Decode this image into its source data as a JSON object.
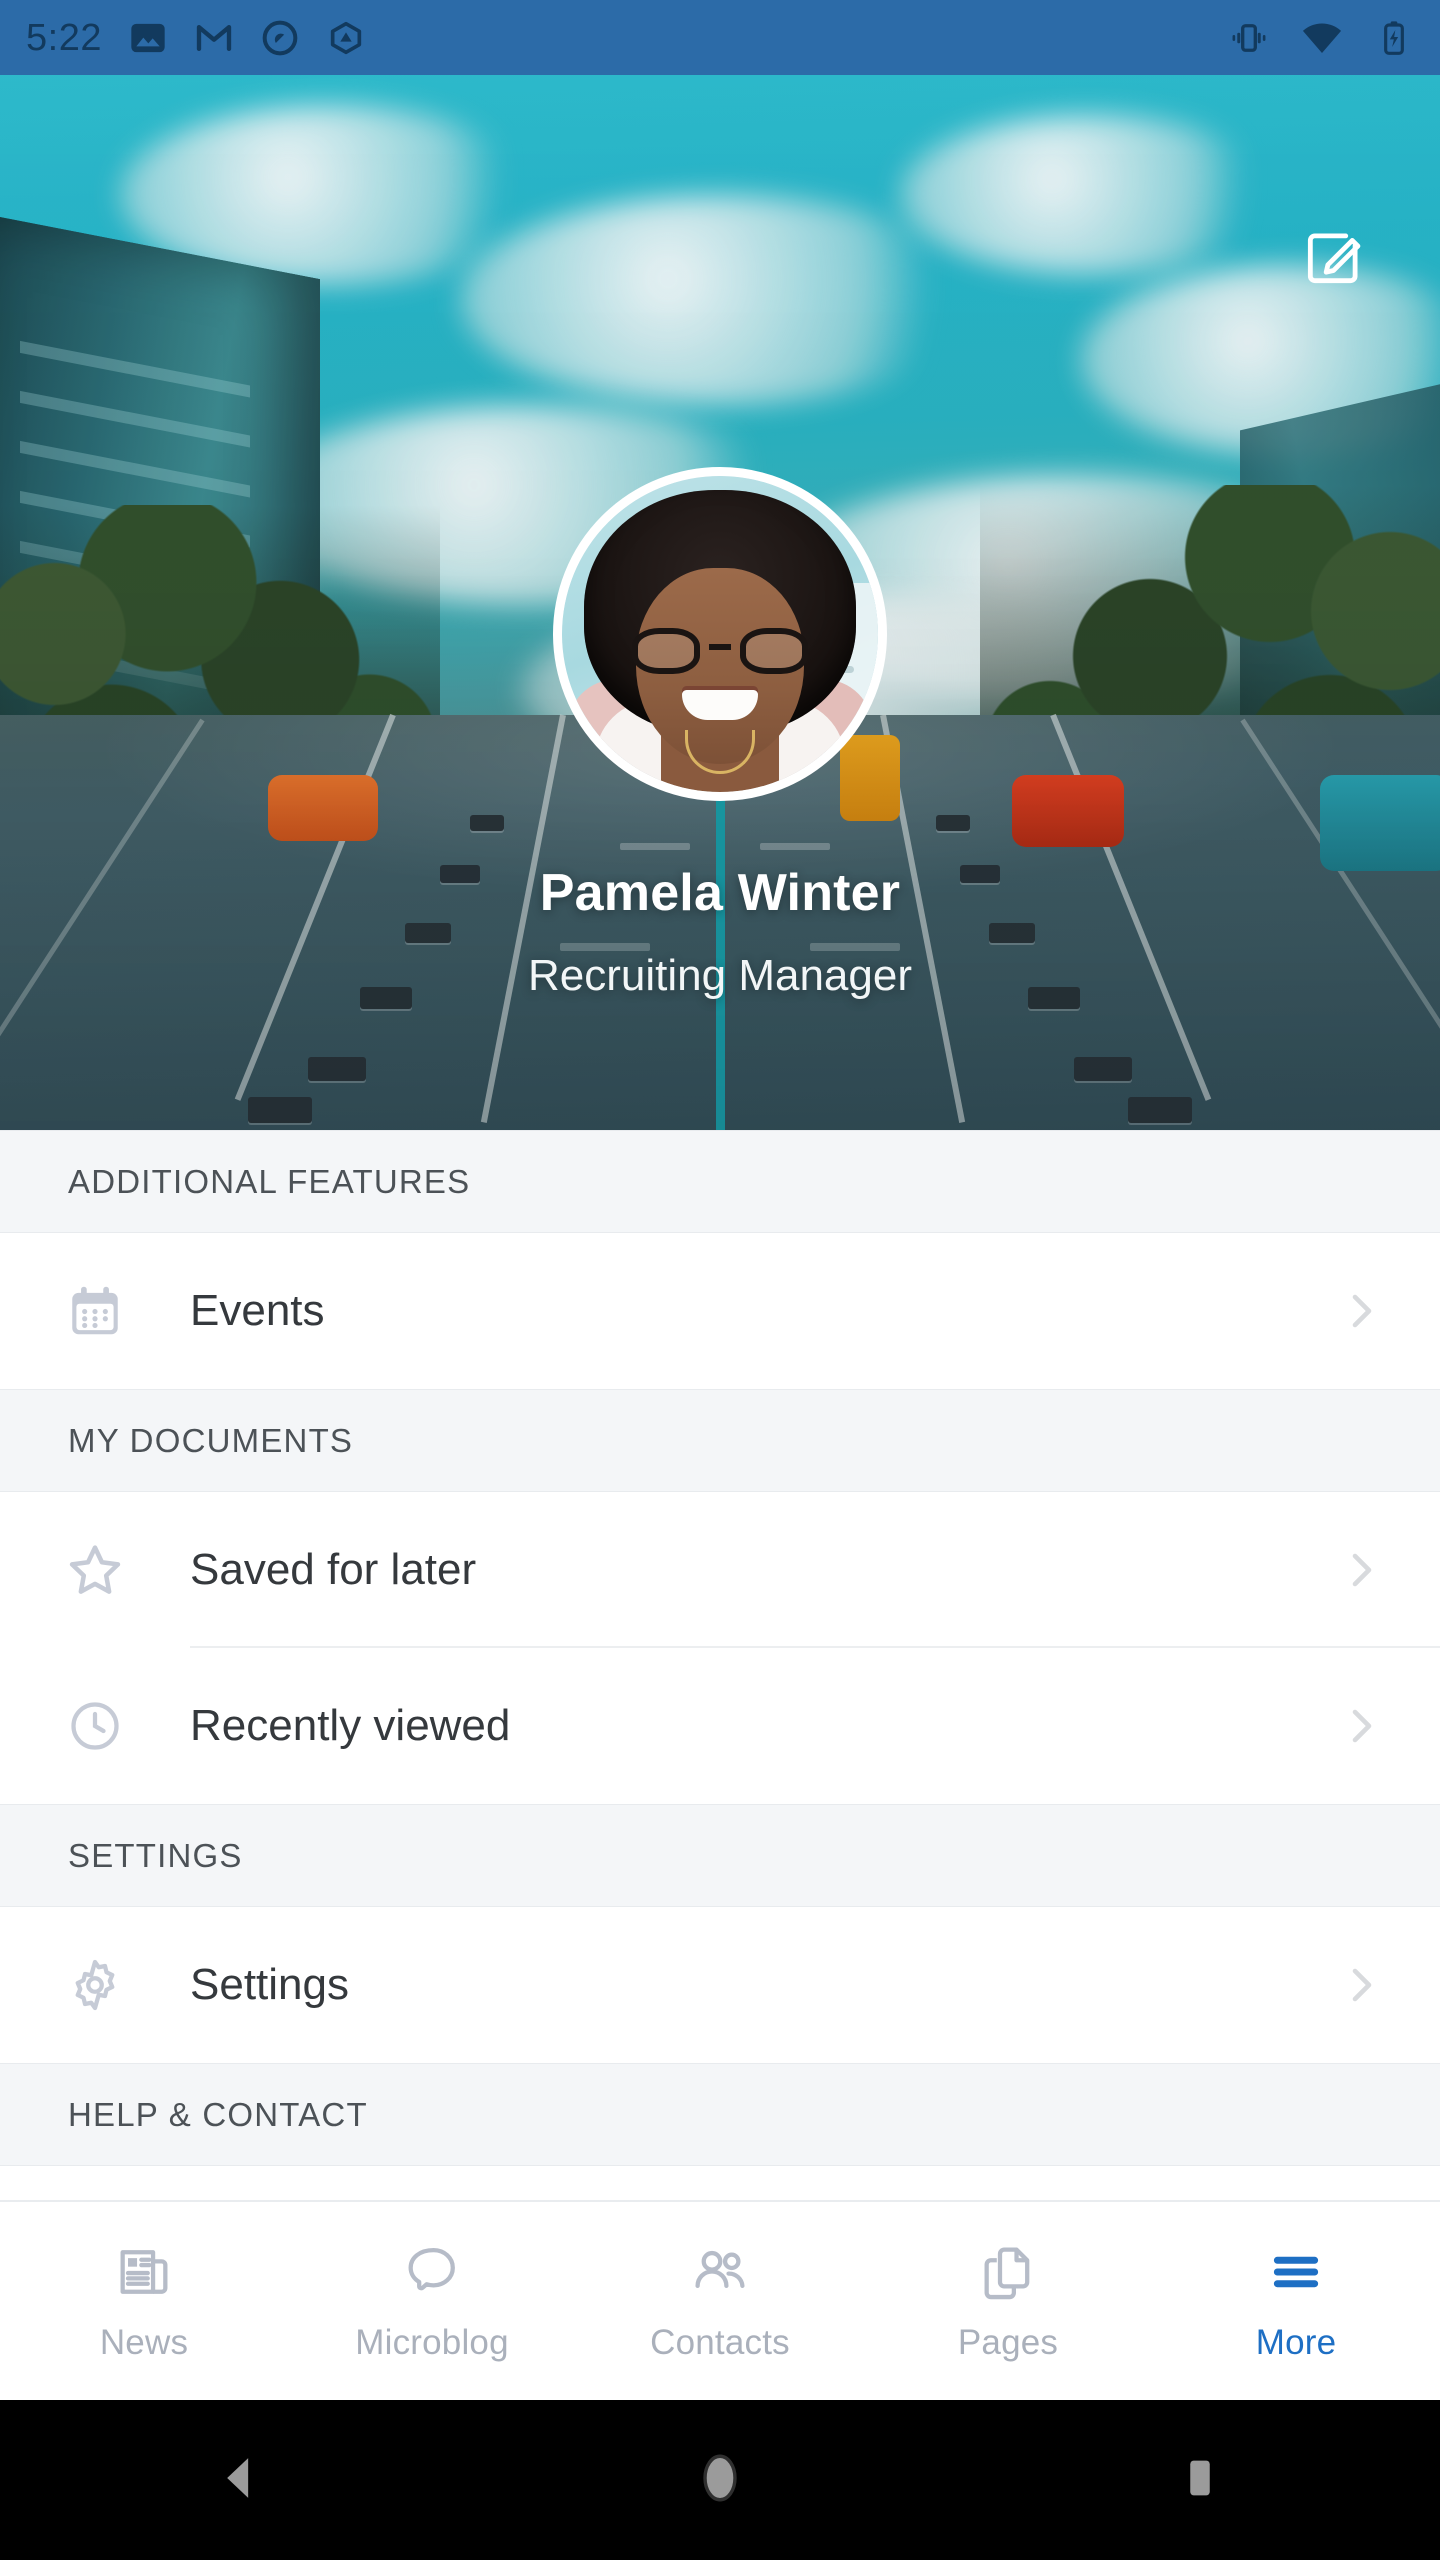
{
  "status_bar": {
    "time": "5:22",
    "left_icons": [
      "photos-icon",
      "gmail-icon",
      "app-circle-icon",
      "drive-triangle-icon"
    ],
    "right_icons": [
      "vibrate-icon",
      "wifi-icon",
      "battery-charging-icon"
    ],
    "background_color": "#2c6ba8"
  },
  "profile": {
    "name": "Pamela Winter",
    "role": "Recruiting Manager",
    "edit_icon": "edit-compose-icon",
    "avatar_alt": "Pamela Winter profile photo",
    "cover_alt": "City street with trees and blue sky"
  },
  "sections": [
    {
      "header": "ADDITIONAL FEATURES",
      "items": [
        {
          "label": "Events",
          "icon": "calendar-icon",
          "chevron": "chevron-right-icon"
        }
      ]
    },
    {
      "header": "MY DOCUMENTS",
      "items": [
        {
          "label": "Saved for later",
          "icon": "star-icon",
          "chevron": "chevron-right-icon"
        },
        {
          "label": "Recently viewed",
          "icon": "clock-icon",
          "chevron": "chevron-right-icon"
        }
      ]
    },
    {
      "header": "SETTINGS",
      "items": [
        {
          "label": "Settings",
          "icon": "gear-icon",
          "chevron": "chevron-right-icon"
        }
      ]
    },
    {
      "header": "HELP & CONTACT",
      "items": []
    }
  ],
  "bottom_nav": {
    "active": "More",
    "active_color": "#1e6fc4",
    "inactive_color": "#aab0bb",
    "items": [
      {
        "label": "News",
        "icon": "newspaper-icon"
      },
      {
        "label": "Microblog",
        "icon": "speech-bubble-icon"
      },
      {
        "label": "Contacts",
        "icon": "people-icon"
      },
      {
        "label": "Pages",
        "icon": "documents-icon"
      },
      {
        "label": "More",
        "icon": "hamburger-menu-icon"
      }
    ]
  },
  "android_nav": {
    "buttons": [
      "back-icon",
      "home-icon",
      "recents-icon"
    ]
  }
}
